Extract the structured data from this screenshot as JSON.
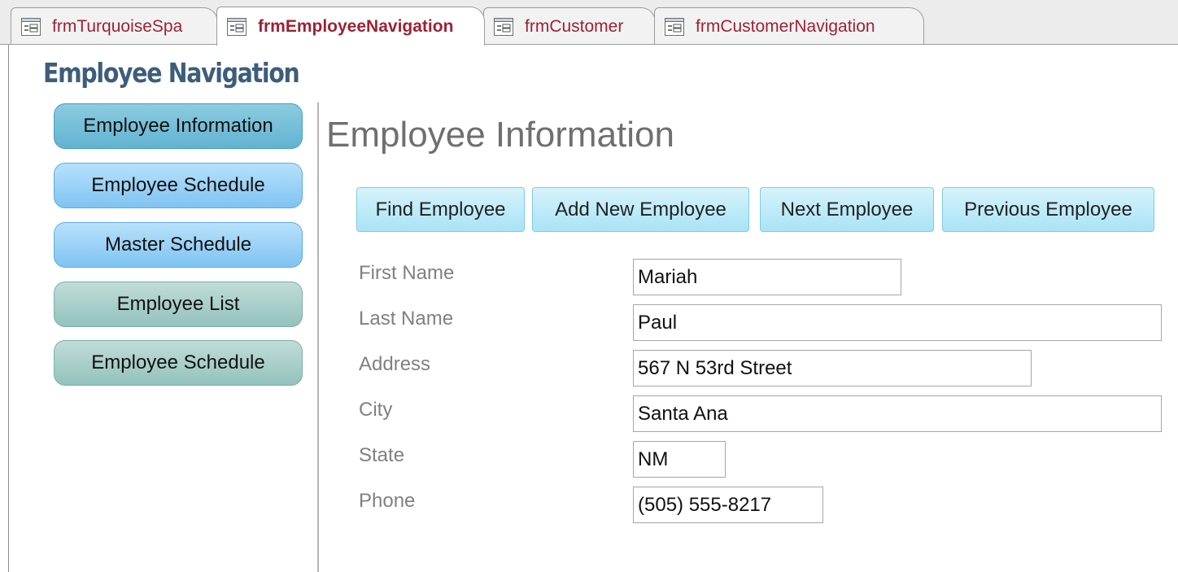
{
  "tabs": [
    {
      "label": "frmTurquoiseSpa",
      "active": false
    },
    {
      "label": "frmEmployeeNavigation",
      "active": true
    },
    {
      "label": "frmCustomer",
      "active": false
    },
    {
      "label": "frmCustomerNavigation",
      "active": false
    }
  ],
  "navigation": {
    "title": "Employee Navigation",
    "items": [
      {
        "label": "Employee Information",
        "selected": true
      },
      {
        "label": "Employee Schedule",
        "selected": false
      },
      {
        "label": "Master Schedule",
        "selected": false
      },
      {
        "label": "Employee List",
        "selected": false
      },
      {
        "label": "Employee Schedule",
        "selected": false
      }
    ]
  },
  "main": {
    "title": "Employee Information",
    "actions": [
      {
        "label": "Find Employee"
      },
      {
        "label": "Add New Employee"
      },
      {
        "label": "Next Employee"
      },
      {
        "label": "Previous Employee"
      }
    ],
    "fields": [
      {
        "label": "First Name",
        "value": "Mariah"
      },
      {
        "label": "Last Name",
        "value": "Paul"
      },
      {
        "label": "Address",
        "value": "567 N 53rd Street"
      },
      {
        "label": "City",
        "value": "Santa Ana"
      },
      {
        "label": "State",
        "value": "NM"
      },
      {
        "label": "Phone",
        "value": "(505) 555-8217"
      }
    ]
  },
  "colors": {
    "tab_text": "#9b2335",
    "nav_title": "#3d5d7a",
    "nav_selected": "#62b3d1",
    "nav_blue": "#7fc3f2",
    "nav_teal": "#93c2bc",
    "action_button": "#a9e3f6",
    "label_text": "#808080"
  },
  "icons": {
    "tab": "form-icon"
  }
}
